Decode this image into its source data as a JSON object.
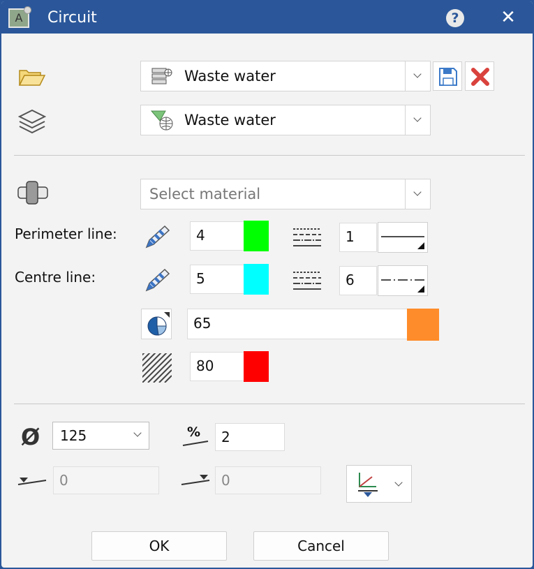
{
  "window": {
    "title": "Circuit"
  },
  "group": {
    "value": "Waste water"
  },
  "layer": {
    "value": "Waste water"
  },
  "material": {
    "placeholder": "Select material"
  },
  "perimeter": {
    "label": "Perimeter line:",
    "pen": "4",
    "pen_color": "#00ff00",
    "linetype": "1"
  },
  "centre": {
    "label": "Centre line:",
    "pen": "5",
    "pen_color": "#00ffff",
    "linetype": "6"
  },
  "fill": {
    "value": "65",
    "color": "#ff8c2a"
  },
  "hatch": {
    "value": "80",
    "color": "#ff0000"
  },
  "diameter": {
    "symbol": "Ø",
    "value": "125"
  },
  "slope": {
    "symbol": "%",
    "value": "2"
  },
  "start_height": {
    "value": "0"
  },
  "end_height": {
    "value": "0"
  },
  "buttons": {
    "ok": "OK",
    "cancel": "Cancel"
  }
}
